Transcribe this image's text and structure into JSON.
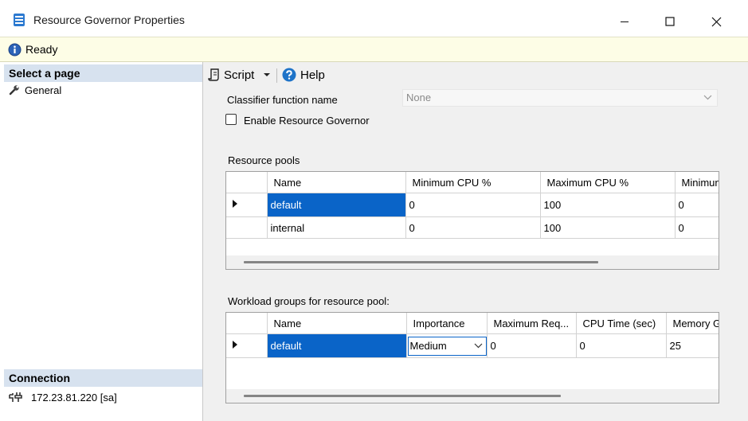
{
  "window": {
    "title": "Resource Governor Properties",
    "minimize_icon": "minimize-icon",
    "maximize_icon": "maximize-icon",
    "close_icon": "close-icon"
  },
  "status": {
    "text": "Ready",
    "icon": "info-icon"
  },
  "left": {
    "select_page_header": "Select a page",
    "pages": [
      {
        "label": "General",
        "icon": "wrench-icon"
      }
    ],
    "connection_header": "Connection",
    "connection": {
      "label": "172.23.81.220 [sa]",
      "icon": "connection-plug-icon"
    }
  },
  "toolbar": {
    "script_label": "Script",
    "help_label": "Help"
  },
  "form": {
    "classifier_label": "Classifier function name",
    "classifier_value": "None",
    "enable_label": "Enable Resource Governor",
    "enable_checked": false
  },
  "resource_pools": {
    "label": "Resource pools",
    "columns": [
      "Name",
      "Minimum CPU %",
      "Maximum CPU %",
      "Minimun"
    ],
    "rows": [
      {
        "name": "default",
        "min_cpu": "0",
        "max_cpu": "100",
        "min_mem": "0"
      },
      {
        "name": "internal",
        "min_cpu": "0",
        "max_cpu": "100",
        "min_mem": "0"
      }
    ]
  },
  "workload_groups": {
    "label": "Workload groups for resource pool:",
    "columns": [
      "Name",
      "Importance",
      "Maximum Req...",
      "CPU Time (sec)",
      "Memory G"
    ],
    "rows": [
      {
        "name": "default",
        "importance": "Medium",
        "max_requests": "0",
        "cpu_time": "0",
        "memory": "25"
      }
    ]
  },
  "colors": {
    "selection": "#0a64c8",
    "status_bg": "#fdfde6",
    "section_header_bg": "#d7e2ef",
    "help_icon": "#1e73c8"
  }
}
